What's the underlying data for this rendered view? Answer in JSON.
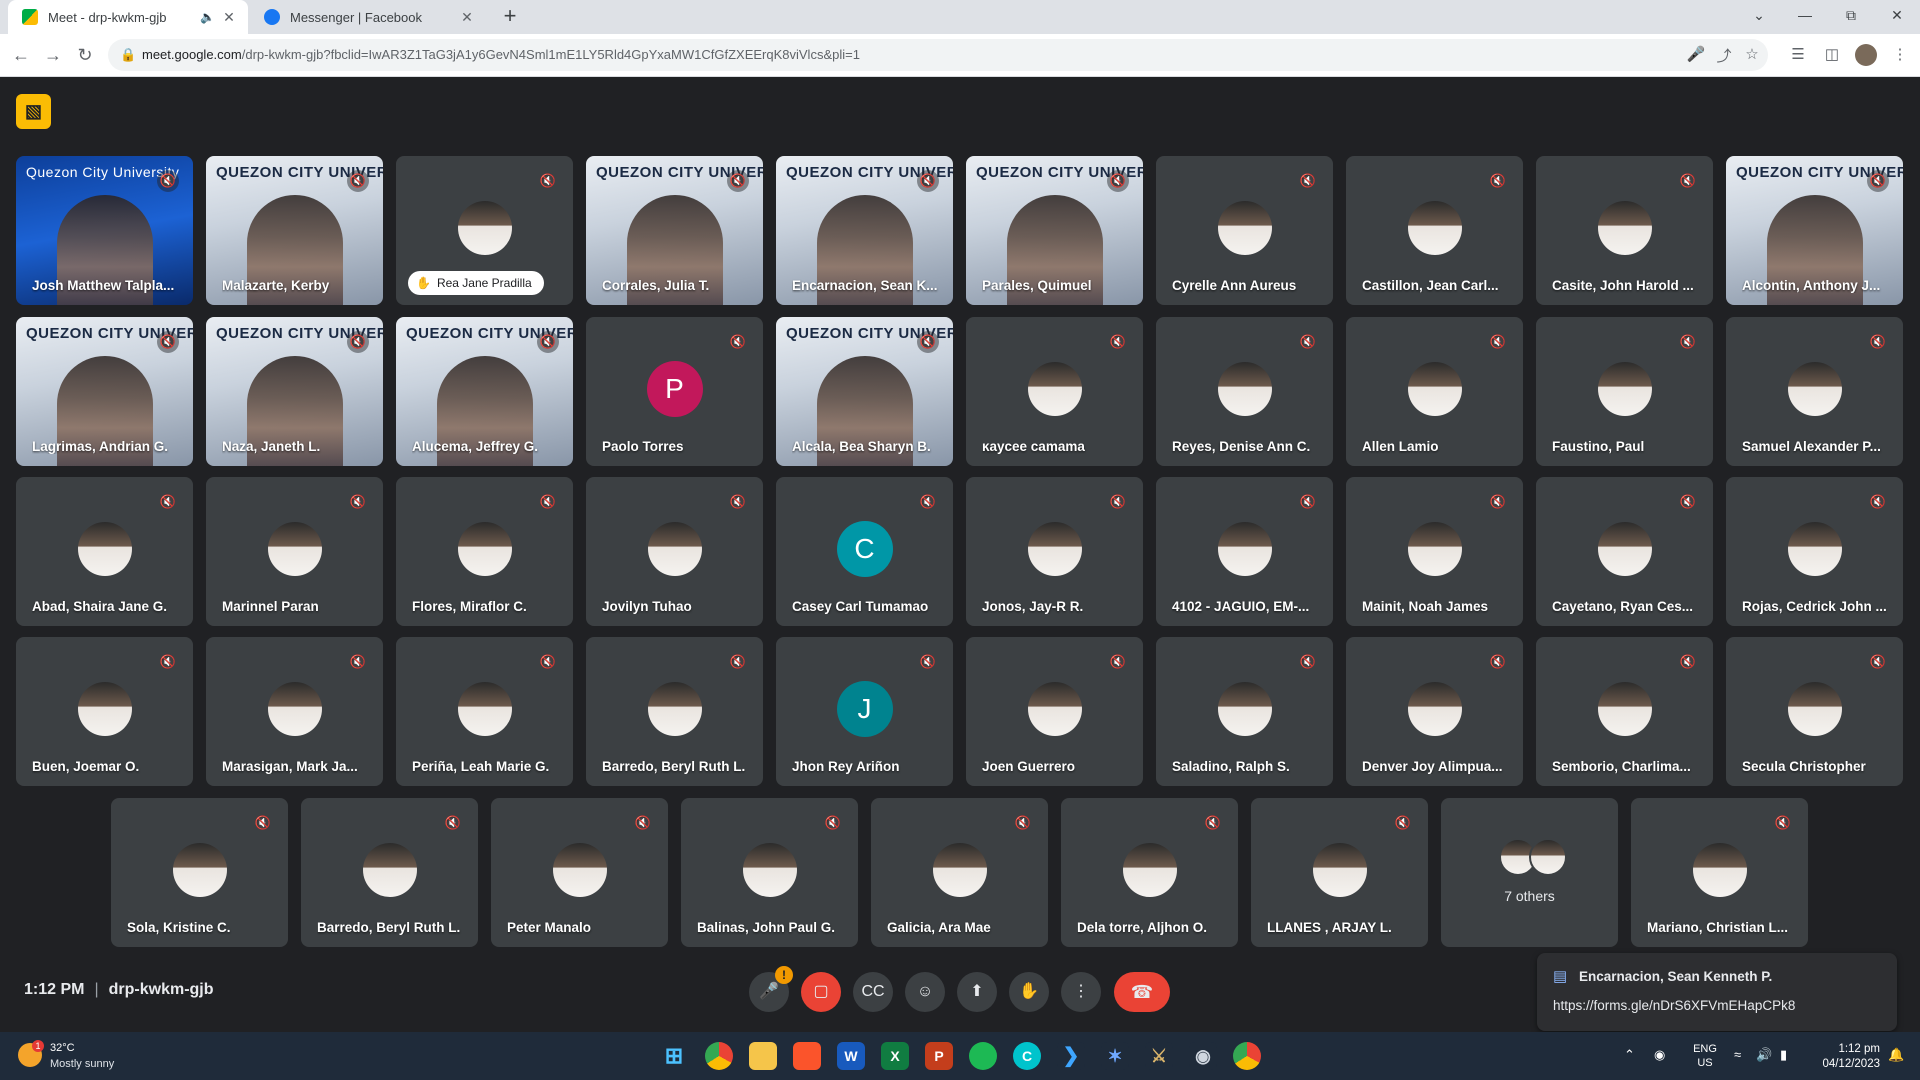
{
  "browser": {
    "tabs": [
      {
        "title": "Meet - drp-kwkm-gjb",
        "active": true,
        "audio": true
      },
      {
        "title": "Messenger | Facebook",
        "active": false
      }
    ],
    "url_host": "meet.google.com",
    "url_rest": "/drp-kwkm-gjb?fbclid=IwAR3Z1TaG3jA1y6GevN4Sml1mE1LY5Rld4GpYxaMW1CfGfZXEErqK8viVlcs&pli=1"
  },
  "meet": {
    "time": "1:12 PM",
    "meeting_code": "drp-kwkm-gjb",
    "participants": [
      {
        "name": "Josh Matthew Talpla...",
        "kind": "video",
        "style": "blue",
        "banner": "Quezon City University"
      },
      {
        "name": "Malazarte, Kerby",
        "kind": "video",
        "style": "uni",
        "banner": "QUEZON CITY UNIVERSITY"
      },
      {
        "name": "Rea Jane Pradilla",
        "kind": "avatar",
        "pill": true
      },
      {
        "name": "Corrales, Julia T.",
        "kind": "video",
        "style": "uni",
        "banner": "QUEZON CITY UNIVERSITY"
      },
      {
        "name": "Encarnacion, Sean K...",
        "kind": "video",
        "style": "uni",
        "banner": "QUEZON CITY UNIVERSITY"
      },
      {
        "name": "Parales, Quimuel",
        "kind": "video",
        "style": "uni",
        "banner": "QUEZON CITY UNIVERSITY"
      },
      {
        "name": "Cyrelle Ann Aureus",
        "kind": "avatar"
      },
      {
        "name": "Castillon, Jean Carl...",
        "kind": "avatar"
      },
      {
        "name": "Casite, John Harold ...",
        "kind": "avatar"
      },
      {
        "name": "Alcontin, Anthony J...",
        "kind": "video",
        "style": "uni",
        "banner": "QUEZON CITY UNIVERSITY"
      },
      {
        "name": "Lagrimas, Andrian G.",
        "kind": "video",
        "style": "uni",
        "banner": "QUEZON CITY UNIVERSITY"
      },
      {
        "name": "Naza, Janeth L.",
        "kind": "video",
        "style": "uni",
        "banner": "QUEZON CITY UNIVERSITY"
      },
      {
        "name": "Alucema, Jeffrey G.",
        "kind": "video",
        "style": "uni",
        "banner": "QUEZON CITY UNIVERSITY"
      },
      {
        "name": "Paolo Torres",
        "kind": "letter",
        "letter": "P",
        "color": "#c2185b"
      },
      {
        "name": "Alcala, Bea Sharyn B.",
        "kind": "video",
        "style": "uni",
        "banner": "QUEZON CITY UNIVERSITY"
      },
      {
        "name": "ĸaycee camama",
        "kind": "avatar"
      },
      {
        "name": "Reyes, Denise Ann C.",
        "kind": "avatar"
      },
      {
        "name": "Allen Lamio",
        "kind": "avatar"
      },
      {
        "name": "Faustino, Paul",
        "kind": "avatar"
      },
      {
        "name": "Samuel Alexander P...",
        "kind": "avatar"
      },
      {
        "name": "Abad, Shaira Jane G.",
        "kind": "avatar"
      },
      {
        "name": "Marinnel Paran",
        "kind": "avatar"
      },
      {
        "name": "Flores, Miraflor C.",
        "kind": "avatar"
      },
      {
        "name": "Jovilyn Tuhao",
        "kind": "avatar"
      },
      {
        "name": "Casey Carl Tumamao",
        "kind": "letter",
        "letter": "C",
        "color": "#0097a7"
      },
      {
        "name": "Jonos, Jay-R R.",
        "kind": "avatar"
      },
      {
        "name": "4102 - JAGUIO, EM-...",
        "kind": "avatar"
      },
      {
        "name": "Mainit, Noah James",
        "kind": "avatar"
      },
      {
        "name": "Cayetano, Ryan Ces...",
        "kind": "avatar"
      },
      {
        "name": "Rojas, Cedrick John ...",
        "kind": "avatar"
      },
      {
        "name": "Buen, Joemar O.",
        "kind": "avatar"
      },
      {
        "name": "Marasigan, Mark Ja...",
        "kind": "avatar"
      },
      {
        "name": "Periña, Leah Marie G.",
        "kind": "avatar"
      },
      {
        "name": "Barredo, Beryl Ruth L.",
        "kind": "avatar"
      },
      {
        "name": "Jhon Rey Ariñon",
        "kind": "letter",
        "letter": "J",
        "color": "#00838f"
      },
      {
        "name": "Joen Guerrero",
        "kind": "avatar"
      },
      {
        "name": "Saladino, Ralph S.",
        "kind": "avatar"
      },
      {
        "name": "Denver Joy Alimpua...",
        "kind": "avatar"
      },
      {
        "name": "Semborio, Charlima...",
        "kind": "avatar"
      },
      {
        "name": "Secula Christopher",
        "kind": "avatar"
      },
      {
        "name": "Sola, Kristine C.",
        "kind": "avatar"
      },
      {
        "name": "Barredo, Beryl Ruth L.",
        "kind": "avatar"
      },
      {
        "name": "Peter Manalo",
        "kind": "avatar"
      },
      {
        "name": "Balinas, John Paul G.",
        "kind": "avatar"
      },
      {
        "name": "Galicia, Ara Mae",
        "kind": "avatar"
      },
      {
        "name": "Dela torre, Aljhon O.",
        "kind": "avatar"
      },
      {
        "name": "LLANES , ARJAY L.",
        "kind": "avatar"
      },
      {
        "name": "7 others",
        "kind": "others"
      },
      {
        "name": "Mariano, Christian L...",
        "kind": "avatar"
      }
    ],
    "chat_popup": {
      "sender": "Encarnacion, Sean Kenneth P.",
      "message": "https://forms.gle/nDrS6XFVmEHapCPk8"
    }
  },
  "taskbar": {
    "weather_temp": "32°C",
    "weather_desc": "Mostly sunny",
    "weather_badge": "1",
    "lang_line1": "ENG",
    "lang_line2": "US",
    "time": "1:12 pm",
    "date": "04/12/2023"
  }
}
